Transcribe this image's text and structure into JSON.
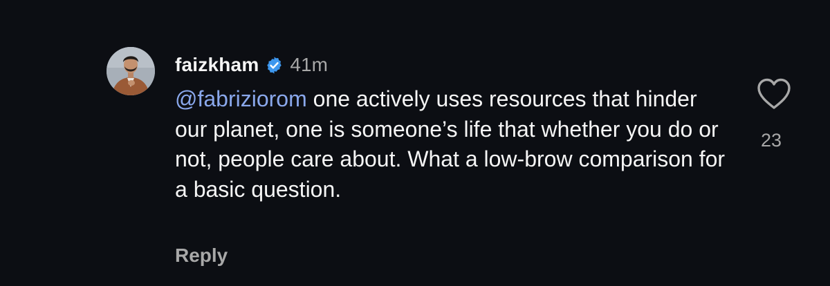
{
  "comment": {
    "username": "faizkham",
    "verified": true,
    "timestamp": "41m",
    "mention": "@fabriziorom",
    "text": " one actively uses resources that hinder our planet, one is someone’s life that whether you do or not, people care about. What a low-brow comparison for a basic question.",
    "like_count": "23",
    "reply_label": "Reply",
    "like_icon": "heart-outline-icon",
    "verified_icon": "verified-badge-icon"
  },
  "colors": {
    "background": "#0c0e13",
    "text": "#f5f5f5",
    "muted": "#a8a8a8",
    "mention": "#8aa8ec",
    "verified": "#3d97ee"
  }
}
